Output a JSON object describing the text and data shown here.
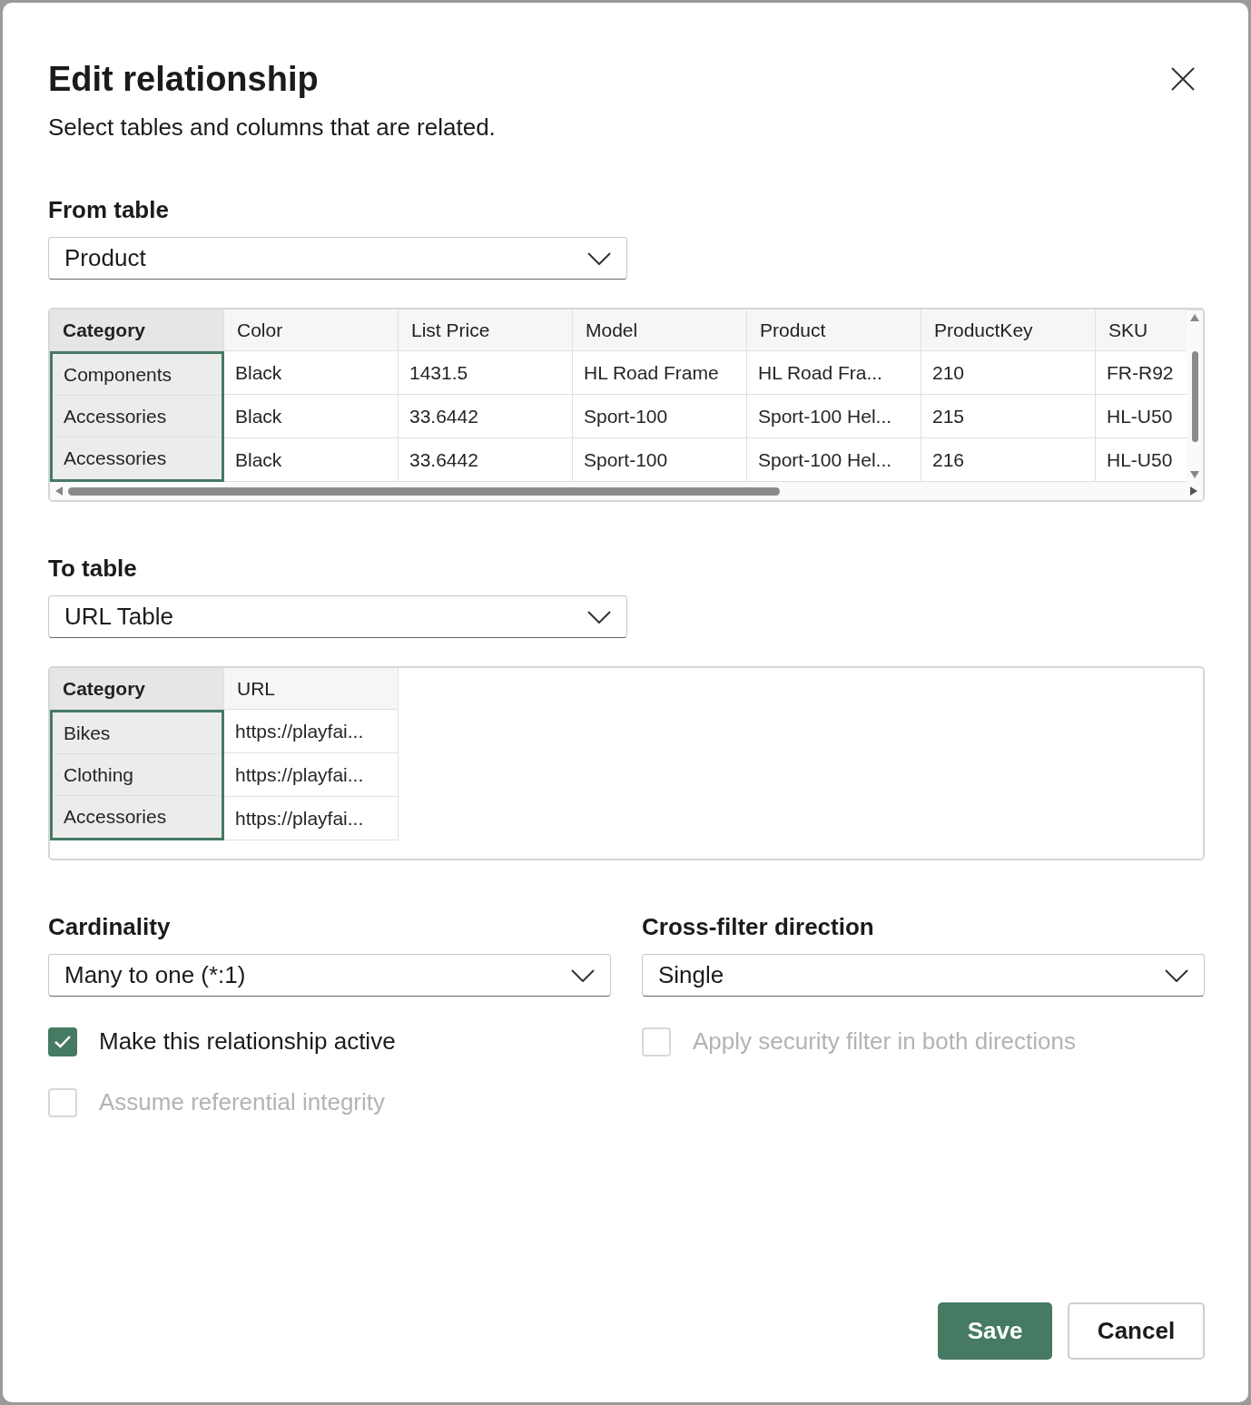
{
  "dialog": {
    "title": "Edit relationship",
    "subtitle": "Select tables and columns that are related."
  },
  "from_table": {
    "label": "From table",
    "dropdown": {
      "value": "Product"
    },
    "table": {
      "columns": [
        {
          "label": "Category",
          "selected": true
        },
        {
          "label": "Color",
          "selected": false
        },
        {
          "label": "List Price",
          "selected": false
        },
        {
          "label": "Model",
          "selected": false
        },
        {
          "label": "Product",
          "selected": false
        },
        {
          "label": "ProductKey",
          "selected": false
        },
        {
          "label": "SKU",
          "selected": false
        }
      ],
      "rows": [
        [
          "Components",
          "Black",
          "1431.5",
          "HL Road Frame",
          "HL Road Fra...",
          "210",
          "FR-R92"
        ],
        [
          "Accessories",
          "Black",
          "33.6442",
          "Sport-100",
          "Sport-100 Hel...",
          "215",
          "HL-U50"
        ],
        [
          "Accessories",
          "Black",
          "33.6442",
          "Sport-100",
          "Sport-100 Hel...",
          "216",
          "HL-U50"
        ]
      ]
    }
  },
  "to_table": {
    "label": "To table",
    "dropdown": {
      "value": "URL Table"
    },
    "table": {
      "columns": [
        {
          "label": "Category",
          "selected": true
        },
        {
          "label": "URL",
          "selected": false
        }
      ],
      "rows": [
        [
          "Bikes",
          "https://playfai..."
        ],
        [
          "Clothing",
          "https://playfai..."
        ],
        [
          "Accessories",
          "https://playfai..."
        ]
      ]
    }
  },
  "cardinality": {
    "label": "Cardinality",
    "value": "Many to one (*:1)"
  },
  "cross_filter_direction": {
    "label": "Cross-filter direction",
    "value": "Single"
  },
  "checkboxes": [
    {
      "label": "Make this relationship active",
      "checked": true,
      "disabled": false
    },
    {
      "label": "Apply security filter in both directions",
      "checked": false,
      "disabled": true
    },
    {
      "label": "Assume referential integrity",
      "checked": false,
      "disabled": true
    }
  ],
  "buttons": [
    {
      "label": "Save",
      "kind": "primary"
    },
    {
      "label": "Cancel",
      "kind": "secondary"
    }
  ]
}
